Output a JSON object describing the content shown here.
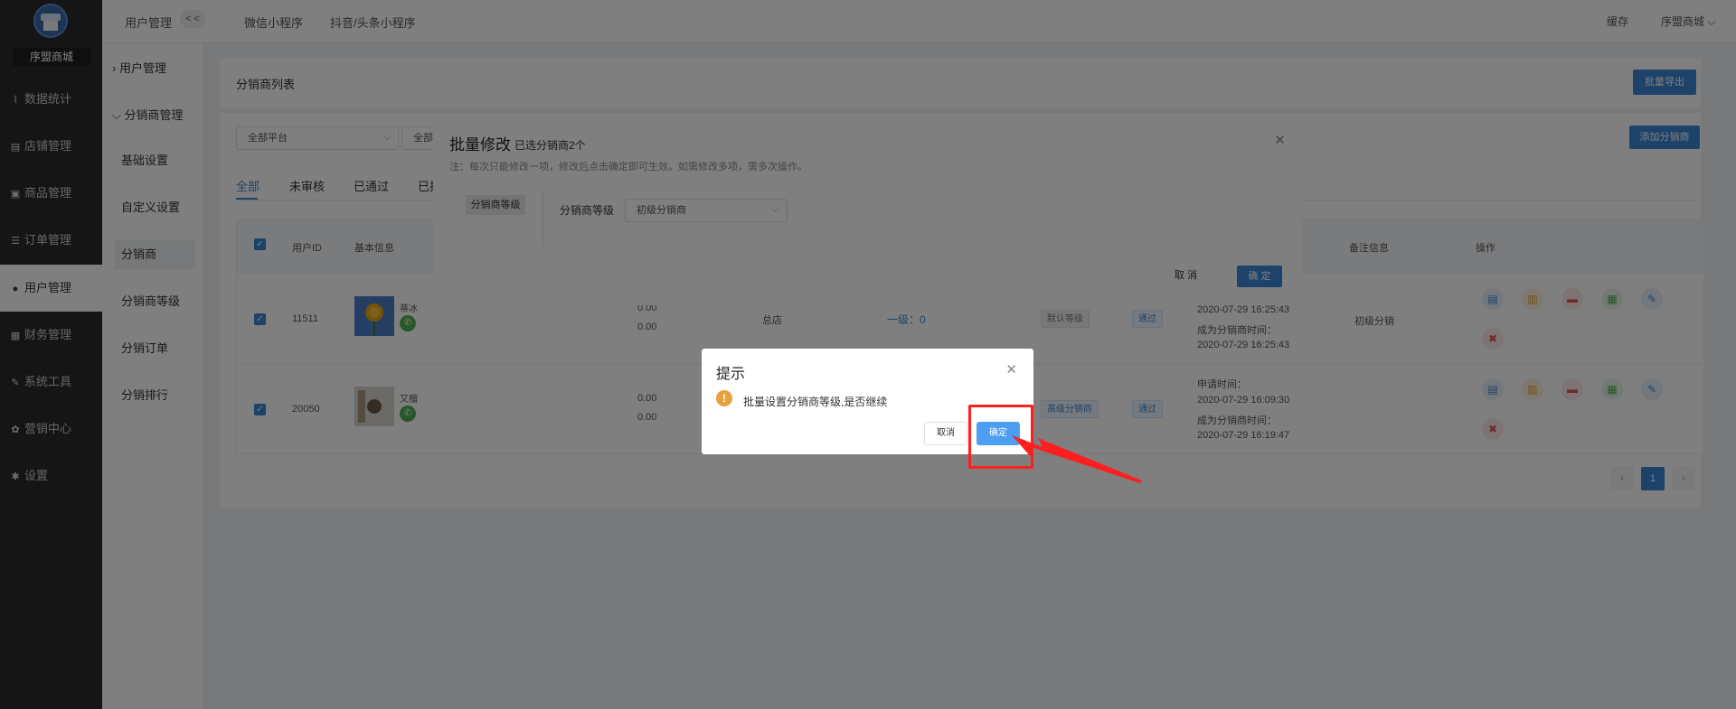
{
  "sidebar": {
    "store_name": "序盟商城",
    "items": [
      {
        "icon": "chart-line-icon",
        "glyph": "⌇",
        "label": "数据统计"
      },
      {
        "icon": "store-icon",
        "glyph": "▤",
        "label": "店铺管理"
      },
      {
        "icon": "goods-icon",
        "glyph": "▣",
        "label": "商品管理"
      },
      {
        "icon": "order-icon",
        "glyph": "☰",
        "label": "订单管理"
      },
      {
        "icon": "user-icon",
        "glyph": "●",
        "label": "用户管理"
      },
      {
        "icon": "finance-icon",
        "glyph": "▦",
        "label": "财务管理"
      },
      {
        "icon": "wrench-icon",
        "glyph": "✎",
        "label": "系统工具"
      },
      {
        "icon": "marketing-icon",
        "glyph": "✿",
        "label": "营销中心"
      },
      {
        "icon": "gear-icon",
        "glyph": "✱",
        "label": "设置"
      }
    ]
  },
  "submenu": {
    "group1": "用户管理",
    "group2": "分销商管理",
    "items": [
      "基础设置",
      "自定义设置",
      "分销商",
      "分销商等级",
      "分销订单",
      "分销排行"
    ]
  },
  "topbar": {
    "crumb": "用户管理",
    "collapse": "< <",
    "tabs": [
      "微信小程序",
      "抖音/头条小程序"
    ],
    "cache": "缓存",
    "store": "序盟商城"
  },
  "page": {
    "title": "分销商列表",
    "export_btn": "批量导出",
    "add_btn": "添加分销商",
    "platform_select": "全部平台",
    "second_select": "全部",
    "filter_tabs": [
      "全部",
      "未审核",
      "已通过",
      "已拒"
    ],
    "columns": {
      "user_id": "用户ID",
      "basic": "基本信息",
      "remark": "备注信息",
      "action": "操作"
    },
    "rows": [
      {
        "id": "11511",
        "name": "蒂冰",
        "amount1": "0.00",
        "amount2": "0.00",
        "store": "总店",
        "level1": "一级：0",
        "grade": "默认等级",
        "status": "通过",
        "time1": "2020-07-29 16:25:43",
        "time_label": "成为分销商时间：",
        "time2": "2020-07-29 16:25:43",
        "remark": "初级分销"
      },
      {
        "id": "20050",
        "name": "又榴",
        "amount1": "0.00",
        "amount2": "0.00",
        "grade": "高级分销商",
        "status": "通过",
        "apply_label": "申请时间：",
        "time1": "2020-07-29 16:09:30",
        "time_label": "成为分销商时间：",
        "time2": "2020-07-29 16:19:47"
      }
    ],
    "page_current": "1"
  },
  "batch_dialog": {
    "title": "批量修改",
    "subtitle": "已选分销商2个",
    "note": "注：每次只能修改一项，修改后点击确定即可生效。如需修改多项，需多次操作。",
    "left_tab": "分销商等级",
    "field_label": "分销商等级",
    "field_value": "初级分销商",
    "cancel": "取 消",
    "ok": "确 定"
  },
  "confirm_dialog": {
    "title": "提示",
    "message": "批量设置分销商等级,是否继续",
    "cancel": "取消",
    "ok": "确定"
  },
  "colors": {
    "accent": "#3a86d4",
    "sidebar": "#2b2b2b",
    "annotation": "#ff1f1f"
  }
}
